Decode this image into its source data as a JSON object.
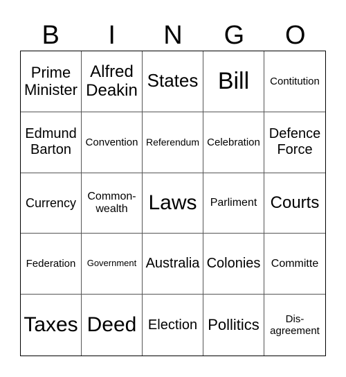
{
  "header": {
    "letters": [
      "B",
      "I",
      "N",
      "G",
      "O"
    ]
  },
  "board": {
    "rows": [
      [
        "Prime\nMinister",
        "Alfred\nDeakin",
        "States",
        "Bill",
        "Contitution"
      ],
      [
        "Edmund\nBarton",
        "Convention",
        "Referendum",
        "Celebration",
        "Defence\nForce"
      ],
      [
        "Currency",
        "Common-\nwealth",
        "Laws",
        "Parliment",
        "Courts"
      ],
      [
        "Federation",
        "Government",
        "Australia",
        "Colonies",
        "Committe"
      ],
      [
        "Taxes",
        "Deed",
        "Election",
        "Pollitics",
        "Dis-\nagreement"
      ]
    ]
  }
}
